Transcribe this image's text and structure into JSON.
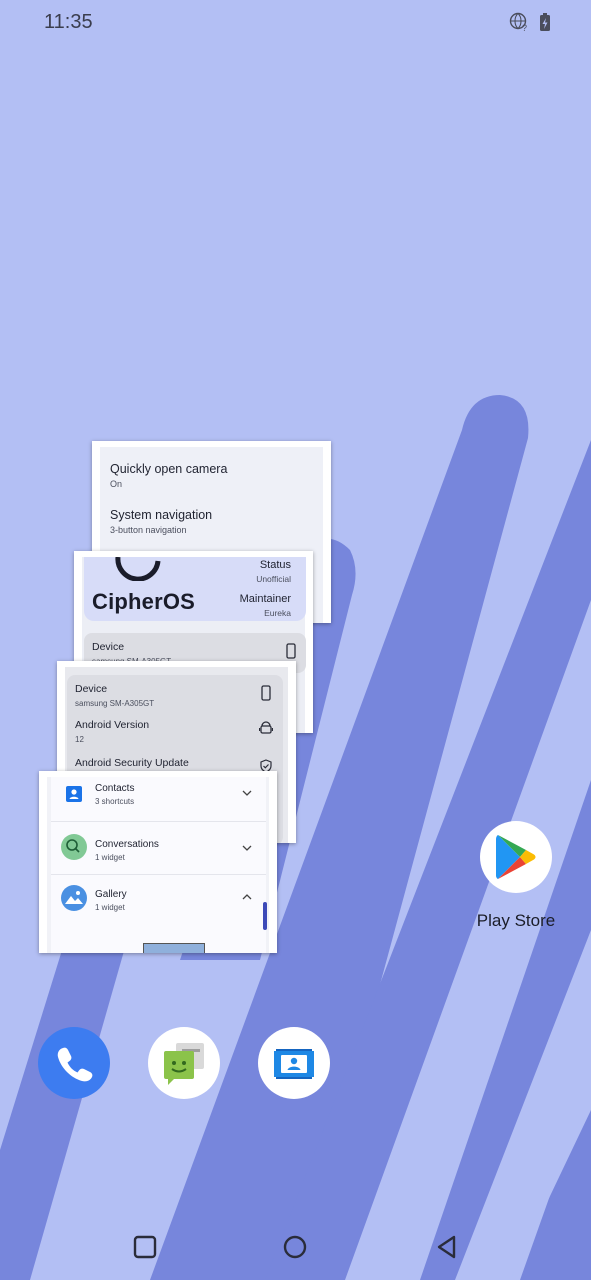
{
  "status_bar": {
    "time": "11:35",
    "icons": [
      "globe-question-icon",
      "battery-charging-icon"
    ]
  },
  "recents": {
    "cards": [
      {
        "app": "settings-gestures",
        "items": [
          {
            "title": "Quickly open camera",
            "subtitle": "On"
          },
          {
            "title": "System navigation",
            "subtitle": "3-button navigation"
          }
        ]
      },
      {
        "app": "about-cipheros",
        "logo_text": "CipherOS",
        "status_label": "Status",
        "status_value": "Unofficial",
        "maintainer_label": "Maintainer",
        "maintainer_value": "Eureka",
        "device_label": "Device",
        "device_value": "samsung SM-A305GT"
      },
      {
        "app": "about-device",
        "rows": [
          {
            "title": "Device",
            "subtitle": "samsung SM-A305GT",
            "icon": "phone-icon"
          },
          {
            "title": "Android Version",
            "subtitle": "12",
            "icon": "android-icon"
          },
          {
            "title": "Android Security Update",
            "subtitle": "",
            "icon": "shield-check-icon"
          }
        ]
      },
      {
        "app": "widgets-picker",
        "rows": [
          {
            "title": "Contacts",
            "subtitle": "3 shortcuts",
            "icon": "contacts-icon",
            "chevron": "chevron-down-icon"
          },
          {
            "title": "Conversations",
            "subtitle": "1 widget",
            "icon": "conversations-icon",
            "chevron": "chevron-down-icon"
          },
          {
            "title": "Gallery",
            "subtitle": "1 widget",
            "icon": "gallery-icon",
            "chevron": "chevron-up-icon"
          }
        ]
      }
    ]
  },
  "home": {
    "play_store_label": "Play Store"
  },
  "dock": [
    "phone-app-icon",
    "messaging-app-icon",
    "contacts-app-icon"
  ],
  "navigation": [
    "recents-button",
    "home-button",
    "back-button"
  ],
  "colors": {
    "wallpaper_light": "#b3bff4",
    "wallpaper_stripe": "#7786dc",
    "phone_blue": "#3d7cf0"
  }
}
